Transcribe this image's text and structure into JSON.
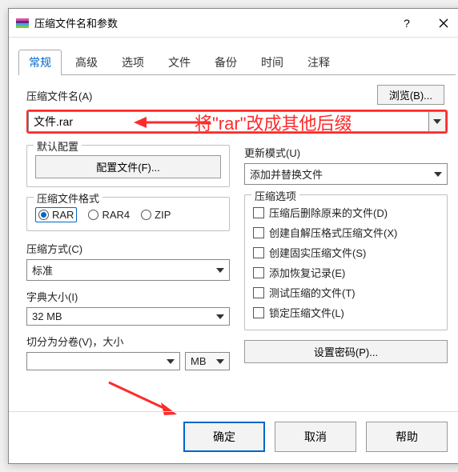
{
  "titlebar": {
    "title": "压缩文件名和参数"
  },
  "tabs": [
    "常规",
    "高级",
    "选项",
    "文件",
    "备份",
    "时间",
    "注释"
  ],
  "active_tab_index": 0,
  "browse_btn": "浏览(B)...",
  "filename_label": "压缩文件名(A)",
  "filename_value": "文件.rar",
  "annotation": "将\"rar\"改成其他后缀",
  "left": {
    "default_config_legend": "默认配置",
    "config_files_btn": "配置文件(F)...",
    "format_legend": "压缩文件格式",
    "formats": [
      "RAR",
      "RAR4",
      "ZIP"
    ],
    "format_selected": 0,
    "method_label": "压缩方式(C)",
    "method_value": "标准",
    "dict_label": "字典大小(I)",
    "dict_value": "32 MB",
    "vol_label": "切分为分卷(V)，大小",
    "vol_value": "",
    "vol_unit": "MB"
  },
  "right": {
    "update_mode_label": "更新模式(U)",
    "update_mode_value": "添加并替换文件",
    "options_legend": "压缩选项",
    "options": [
      "压缩后删除原来的文件(D)",
      "创建自解压格式压缩文件(X)",
      "创建固实压缩文件(S)",
      "添加恢复记录(E)",
      "测试压缩的文件(T)",
      "锁定压缩文件(L)"
    ],
    "set_password_btn": "设置密码(P)..."
  },
  "footer": {
    "ok": "确定",
    "cancel": "取消",
    "help": "帮助"
  },
  "colors": {
    "accent": "#0066cc",
    "annotate": "#ff2a2a"
  }
}
